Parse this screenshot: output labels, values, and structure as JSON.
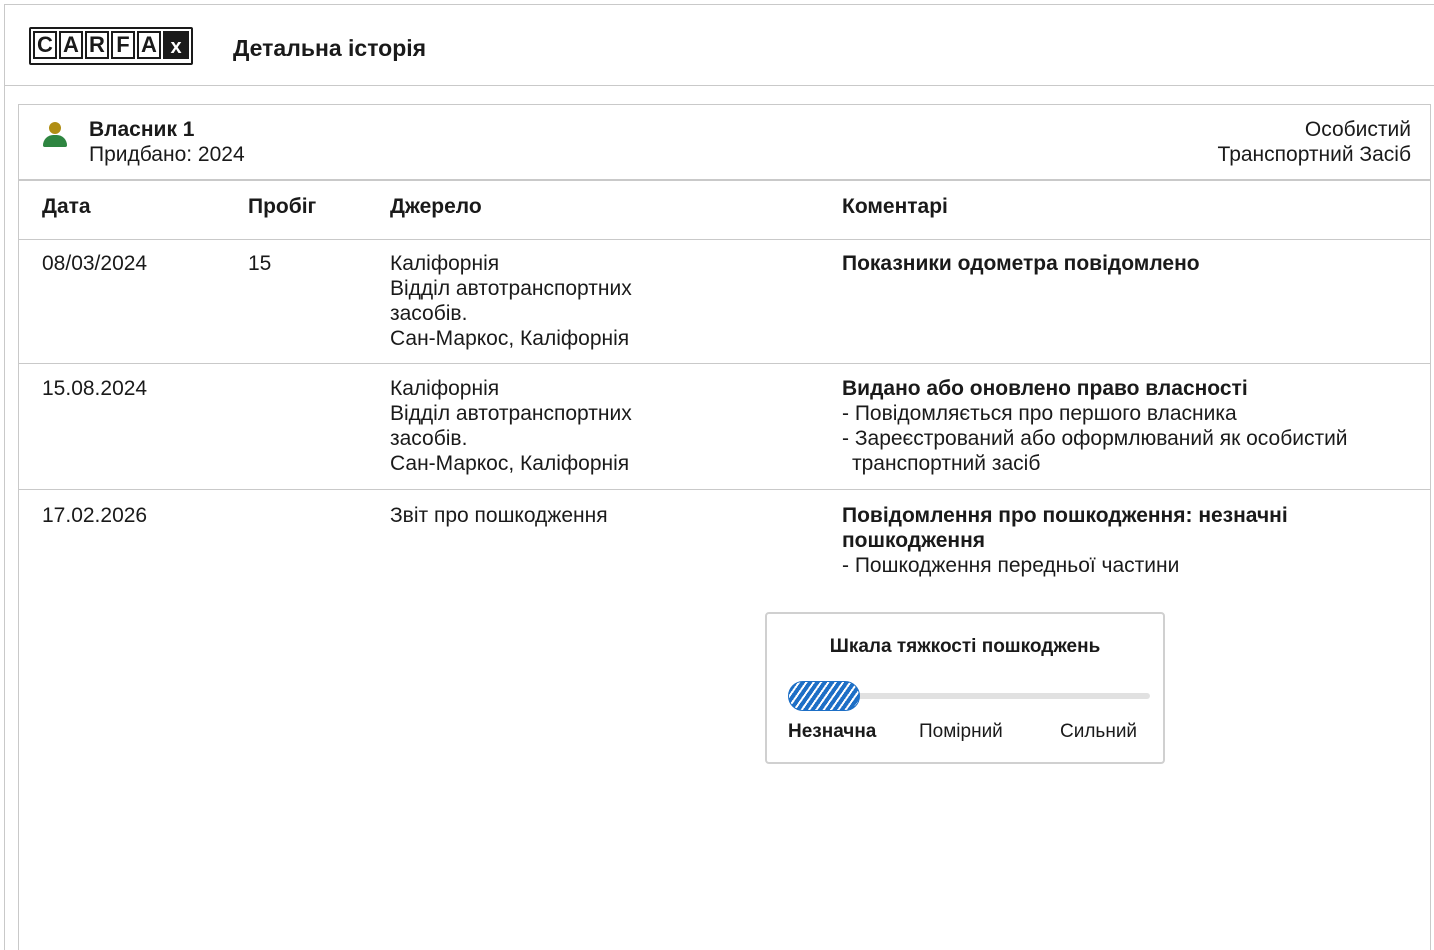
{
  "header": {
    "logo_letters": [
      "C",
      "A",
      "R",
      "F",
      "A",
      "X"
    ],
    "title": "Детальна історія"
  },
  "owner": {
    "icon": "person-icon",
    "name": "Власник 1",
    "purchased": "Придбано: 2024",
    "type_line1": "Особистий",
    "type_line2": "Транспортний Засіб",
    "icon_colors": {
      "head": "#b08e14",
      "body": "#2e8540"
    }
  },
  "table": {
    "headers": {
      "date": "Дата",
      "mileage": "Пробіг",
      "source": "Джерело",
      "comments": "Коментарі"
    },
    "rows": [
      {
        "date": "08/03/2024",
        "mileage": "15",
        "source": [
          "Каліфорнія",
          "Відділ автотранспортних",
          "засобів.",
          "Сан-Маркос, Каліфорнія"
        ],
        "comment_title": "Показники одометра повідомлено",
        "comment_items": []
      },
      {
        "date": "15.08.2024",
        "mileage": "",
        "source": [
          "Каліфорнія",
          "Відділ автотранспортних",
          "засобів.",
          "Сан-Маркос, Каліфорнія"
        ],
        "comment_title": "Видано або оновлено право власності",
        "comment_items": [
          "- Повідомляється про першого власника",
          "- Зареєстрований або оформлюваний як особистий транспортний засіб"
        ]
      },
      {
        "date": "17.02.2026",
        "mileage": "",
        "source": [
          "Звіт про пошкодження"
        ],
        "comment_title": "Повідомлення про пошкодження: незначні пошкодження",
        "comment_items": [
          "- Пошкодження передньої частини"
        ]
      }
    ]
  },
  "severity": {
    "title": "Шкала тяжкості пошкоджень",
    "level_fraction": 0.2,
    "fill_color": "#1d6fc6",
    "labels": [
      "Незначна",
      "Помірний",
      "Сильний"
    ],
    "active_label": "Незначна"
  }
}
